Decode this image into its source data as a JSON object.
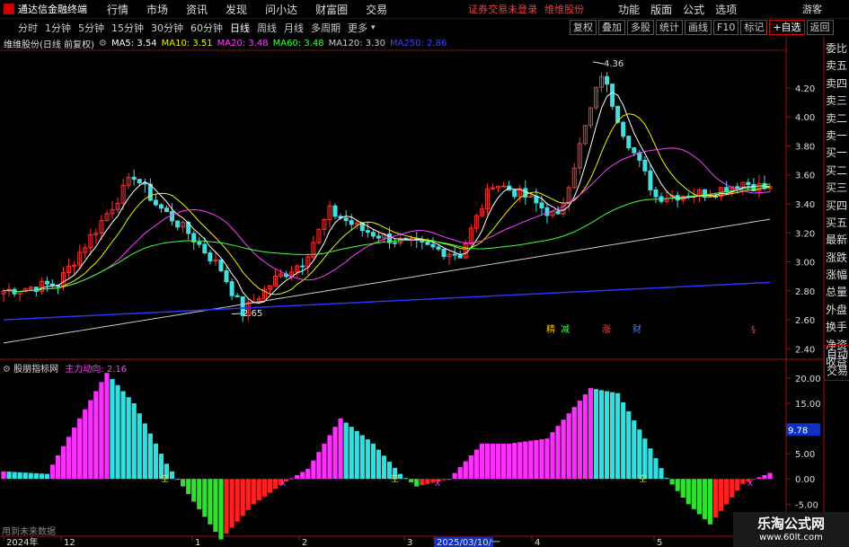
{
  "menubar": {
    "app_title": "通达信金融终端",
    "items": [
      "行情",
      "市场",
      "资讯",
      "发现",
      "问小达",
      "财富圈",
      "交易"
    ],
    "notice": "证券交易未登录",
    "stock_name": "维维股份",
    "right_items": [
      "功能",
      "版面",
      "公式",
      "选项"
    ],
    "user": "游客"
  },
  "toolbar": {
    "periods": [
      "分时",
      "1分钟",
      "5分钟",
      "15分钟",
      "30分钟",
      "60分钟",
      "日线",
      "周线",
      "月线",
      "多周期",
      "更多"
    ],
    "active_period": "日线",
    "right_buttons": [
      "复权",
      "叠加",
      "多股",
      "统计",
      "画线",
      "F10",
      "标记",
      "+自选",
      "返回"
    ]
  },
  "infobar": {
    "title": "维维股份(日线 前复权)",
    "ma": [
      {
        "label": "MA5: 3.54",
        "color": "#ffffff"
      },
      {
        "label": "MA10: 3.51",
        "color": "#f0f000"
      },
      {
        "label": "MA20: 3.48",
        "color": "#ff40ff"
      },
      {
        "label": "MA60: 3.48",
        "color": "#40ff40"
      },
      {
        "label": "MA120: 3.30",
        "color": "#cccccc"
      },
      {
        "label": "MA250: 2.86",
        "color": "#4040ff"
      }
    ]
  },
  "sidepanel": [
    "委比",
    "卖五",
    "卖四",
    "卖三",
    "卖二",
    "卖一",
    "买一",
    "买二",
    "买三",
    "买四",
    "买五",
    "最新",
    "涨跌",
    "涨幅",
    "总量",
    "外盘",
    "换手",
    "净资",
    "收益"
  ],
  "autobox": [
    "自动",
    "交易"
  ],
  "price_axis": [
    "4.20",
    "4.00",
    "3.80",
    "3.60",
    "3.40",
    "3.20",
    "3.00",
    "2.80",
    "2.60",
    "2.40"
  ],
  "price_annotations": {
    "high": "4.36",
    "low": "2.65"
  },
  "event_tags": [
    {
      "text": "精",
      "color": "#f0c000"
    },
    {
      "text": "减",
      "color": "#40ff40"
    },
    {
      "text": "涨",
      "color": "#ff4040"
    },
    {
      "text": "财",
      "color": "#4080ff"
    },
    {
      "text": "§",
      "color": "#ff4040"
    }
  ],
  "indicator": {
    "name": "股朋指标网",
    "line_label": "主力动向: 2.16",
    "axis": [
      "20.00",
      "15.00",
      "10.00",
      "5.00",
      "0.00",
      "-5.00",
      "-10.00"
    ],
    "current_value": "9.78",
    "markers": [
      "空",
      "空",
      "空",
      "空"
    ],
    "x_markers": [
      "X",
      "X",
      "X"
    ]
  },
  "time_axis": [
    "2024年",
    "12",
    "1",
    "2",
    "3",
    "2025/03/10/一",
    "4",
    "5"
  ],
  "footer_note": "用到未来数据",
  "watermark": {
    "line1": "乐淘公式网",
    "line2": "www.60lt.com"
  },
  "colors": {
    "up": "#ff3030",
    "down": "#40e0e0",
    "magenta": "#ff30ff",
    "green": "#30e030",
    "red": "#ff2020",
    "cyan": "#30e0e0"
  }
}
